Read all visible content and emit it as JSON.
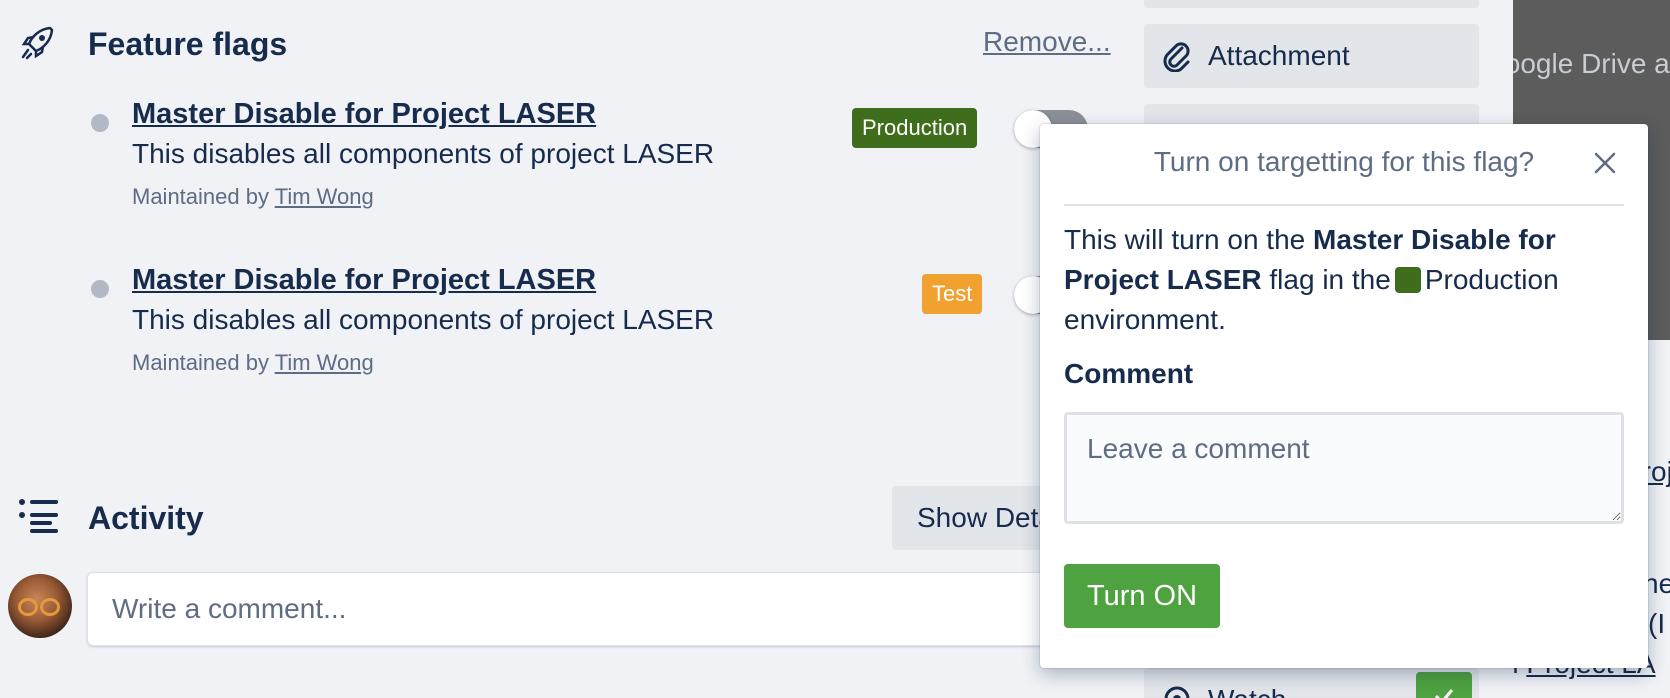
{
  "feature_flags": {
    "title": "Feature flags",
    "remove_label": "Remove...",
    "flags": [
      {
        "name": "Master Disable for Project LASER",
        "description": "This disables all components of project LASER",
        "maintained_prefix": "Maintained by",
        "maintainer": "Tim Wong",
        "environment": "Production",
        "environment_color": "#3e6e1b"
      },
      {
        "name": "Master Disable for Project LASER",
        "description": "This disables all components of project LASER",
        "maintained_prefix": "Maintained by",
        "maintainer": "Tim Wong",
        "environment": "Test",
        "environment_color": "#f1a12f"
      }
    ]
  },
  "activity": {
    "title": "Activity",
    "show_details_label": "Show Details",
    "comment_placeholder": "Write a comment..."
  },
  "sidebar": {
    "attachment_label": "Attachment",
    "watch_label": "Watch"
  },
  "background_text": {
    "google_drive": "Google Drive and",
    "project_partial": "Project LA",
    "proje_partial": "Proje",
    "he_partial": "he",
    "paren_partial": "(I",
    "n_partial": "n"
  },
  "popover": {
    "title": "Turn on targetting for this flag?",
    "message_prefix": "This will turn on the",
    "flag_name": "Master Disable for Project LASER",
    "message_middle": "flag in the",
    "environment": "Production",
    "message_suffix": "environment.",
    "comment_label": "Comment",
    "comment_placeholder": "Leave a comment",
    "submit_label": "Turn ON"
  },
  "colors": {
    "production": "#3e6e1b",
    "test": "#f1a12f",
    "primary_button": "#4ea23f",
    "text": "#172b4d",
    "muted_text": "#5e6c84"
  }
}
